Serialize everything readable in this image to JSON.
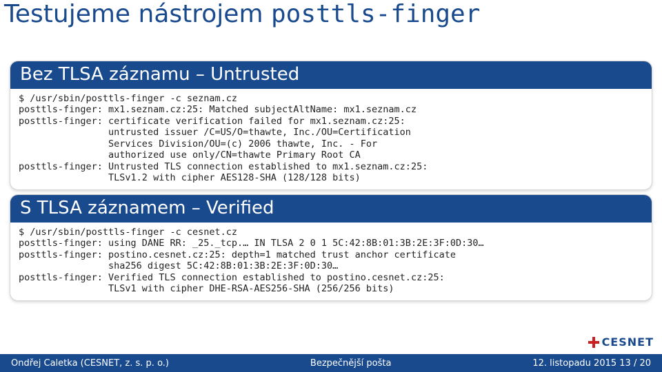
{
  "title_a": "Testujeme nástrojem ",
  "title_b": "posttls-finger",
  "block1": {
    "heading": "Bez TLSA záznamu – Untrusted",
    "text": "$ /usr/sbin/posttls-finger -c seznam.cz\nposttls-finger: mx1.seznam.cz:25: Matched subjectAltName: mx1.seznam.cz\nposttls-finger: certificate verification failed for mx1.seznam.cz:25:\n                untrusted issuer /C=US/O=thawte, Inc./OU=Certification\n                Services Division/OU=(c) 2006 thawte, Inc. - For\n                authorized use only/CN=thawte Primary Root CA\nposttls-finger: Untrusted TLS connection established to mx1.seznam.cz:25:\n                TLSv1.2 with cipher AES128-SHA (128/128 bits)"
  },
  "block2": {
    "heading": "S TLSA záznamem – Verified",
    "text": "$ /usr/sbin/posttls-finger -c cesnet.cz\nposttls-finger: using DANE RR: _25._tcp.… IN TLSA 2 0 1 5C:42:8B:01:3B:2E:3F:0D:30…\nposttls-finger: postino.cesnet.cz:25: depth=1 matched trust anchor certificate\n                sha256 digest 5C:42:8B:01:3B:2E:3F:0D:30…\nposttls-finger: Verified TLS connection established to postino.cesnet.cz:25:\n                TLSv1 with cipher DHE-RSA-AES256-SHA (256/256 bits)"
  },
  "logo_text": "CESNET",
  "footer": {
    "left": "Ondřej Caletka (CESNET, z. s. p. o.)",
    "center": "Bezpečnější pošta",
    "right": "12. listopadu 2015    13 / 20"
  }
}
